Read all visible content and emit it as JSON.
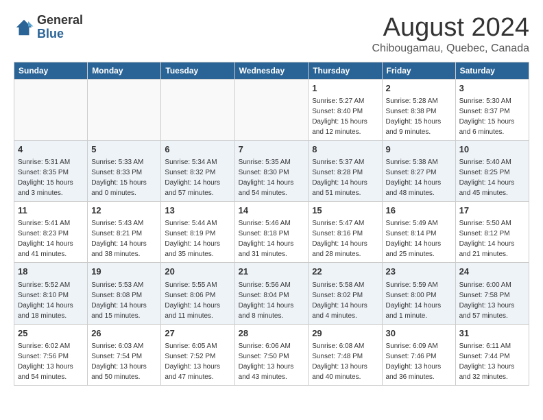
{
  "header": {
    "logo_line1": "General",
    "logo_line2": "Blue",
    "month": "August 2024",
    "location": "Chibougamau, Quebec, Canada"
  },
  "weekdays": [
    "Sunday",
    "Monday",
    "Tuesday",
    "Wednesday",
    "Thursday",
    "Friday",
    "Saturday"
  ],
  "weeks": [
    [
      {
        "day": "",
        "info": ""
      },
      {
        "day": "",
        "info": ""
      },
      {
        "day": "",
        "info": ""
      },
      {
        "day": "",
        "info": ""
      },
      {
        "day": "1",
        "info": "Sunrise: 5:27 AM\nSunset: 8:40 PM\nDaylight: 15 hours and 12 minutes."
      },
      {
        "day": "2",
        "info": "Sunrise: 5:28 AM\nSunset: 8:38 PM\nDaylight: 15 hours and 9 minutes."
      },
      {
        "day": "3",
        "info": "Sunrise: 5:30 AM\nSunset: 8:37 PM\nDaylight: 15 hours and 6 minutes."
      }
    ],
    [
      {
        "day": "4",
        "info": "Sunrise: 5:31 AM\nSunset: 8:35 PM\nDaylight: 15 hours and 3 minutes."
      },
      {
        "day": "5",
        "info": "Sunrise: 5:33 AM\nSunset: 8:33 PM\nDaylight: 15 hours and 0 minutes."
      },
      {
        "day": "6",
        "info": "Sunrise: 5:34 AM\nSunset: 8:32 PM\nDaylight: 14 hours and 57 minutes."
      },
      {
        "day": "7",
        "info": "Sunrise: 5:35 AM\nSunset: 8:30 PM\nDaylight: 14 hours and 54 minutes."
      },
      {
        "day": "8",
        "info": "Sunrise: 5:37 AM\nSunset: 8:28 PM\nDaylight: 14 hours and 51 minutes."
      },
      {
        "day": "9",
        "info": "Sunrise: 5:38 AM\nSunset: 8:27 PM\nDaylight: 14 hours and 48 minutes."
      },
      {
        "day": "10",
        "info": "Sunrise: 5:40 AM\nSunset: 8:25 PM\nDaylight: 14 hours and 45 minutes."
      }
    ],
    [
      {
        "day": "11",
        "info": "Sunrise: 5:41 AM\nSunset: 8:23 PM\nDaylight: 14 hours and 41 minutes."
      },
      {
        "day": "12",
        "info": "Sunrise: 5:43 AM\nSunset: 8:21 PM\nDaylight: 14 hours and 38 minutes."
      },
      {
        "day": "13",
        "info": "Sunrise: 5:44 AM\nSunset: 8:19 PM\nDaylight: 14 hours and 35 minutes."
      },
      {
        "day": "14",
        "info": "Sunrise: 5:46 AM\nSunset: 8:18 PM\nDaylight: 14 hours and 31 minutes."
      },
      {
        "day": "15",
        "info": "Sunrise: 5:47 AM\nSunset: 8:16 PM\nDaylight: 14 hours and 28 minutes."
      },
      {
        "day": "16",
        "info": "Sunrise: 5:49 AM\nSunset: 8:14 PM\nDaylight: 14 hours and 25 minutes."
      },
      {
        "day": "17",
        "info": "Sunrise: 5:50 AM\nSunset: 8:12 PM\nDaylight: 14 hours and 21 minutes."
      }
    ],
    [
      {
        "day": "18",
        "info": "Sunrise: 5:52 AM\nSunset: 8:10 PM\nDaylight: 14 hours and 18 minutes."
      },
      {
        "day": "19",
        "info": "Sunrise: 5:53 AM\nSunset: 8:08 PM\nDaylight: 14 hours and 15 minutes."
      },
      {
        "day": "20",
        "info": "Sunrise: 5:55 AM\nSunset: 8:06 PM\nDaylight: 14 hours and 11 minutes."
      },
      {
        "day": "21",
        "info": "Sunrise: 5:56 AM\nSunset: 8:04 PM\nDaylight: 14 hours and 8 minutes."
      },
      {
        "day": "22",
        "info": "Sunrise: 5:58 AM\nSunset: 8:02 PM\nDaylight: 14 hours and 4 minutes."
      },
      {
        "day": "23",
        "info": "Sunrise: 5:59 AM\nSunset: 8:00 PM\nDaylight: 14 hours and 1 minute."
      },
      {
        "day": "24",
        "info": "Sunrise: 6:00 AM\nSunset: 7:58 PM\nDaylight: 13 hours and 57 minutes."
      }
    ],
    [
      {
        "day": "25",
        "info": "Sunrise: 6:02 AM\nSunset: 7:56 PM\nDaylight: 13 hours and 54 minutes."
      },
      {
        "day": "26",
        "info": "Sunrise: 6:03 AM\nSunset: 7:54 PM\nDaylight: 13 hours and 50 minutes."
      },
      {
        "day": "27",
        "info": "Sunrise: 6:05 AM\nSunset: 7:52 PM\nDaylight: 13 hours and 47 minutes."
      },
      {
        "day": "28",
        "info": "Sunrise: 6:06 AM\nSunset: 7:50 PM\nDaylight: 13 hours and 43 minutes."
      },
      {
        "day": "29",
        "info": "Sunrise: 6:08 AM\nSunset: 7:48 PM\nDaylight: 13 hours and 40 minutes."
      },
      {
        "day": "30",
        "info": "Sunrise: 6:09 AM\nSunset: 7:46 PM\nDaylight: 13 hours and 36 minutes."
      },
      {
        "day": "31",
        "info": "Sunrise: 6:11 AM\nSunset: 7:44 PM\nDaylight: 13 hours and 32 minutes."
      }
    ]
  ]
}
